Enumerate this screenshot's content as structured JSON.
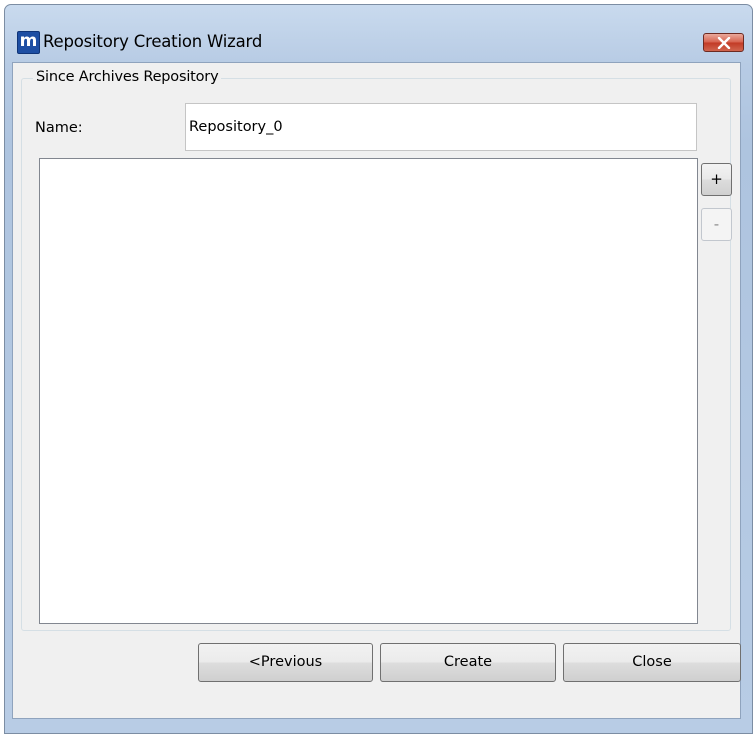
{
  "window": {
    "title": "Repository Creation Wizard",
    "app_icon_letter": "m"
  },
  "group": {
    "legend": "Since Archives Repository"
  },
  "name_field": {
    "label": "Name:",
    "value": "Repository_0"
  },
  "list": {
    "items": []
  },
  "side_buttons": {
    "add_label": "+",
    "remove_label": "-",
    "remove_enabled": false
  },
  "footer": {
    "previous_label": "<Previous",
    "create_label": "Create",
    "close_label": "Close"
  },
  "colors": {
    "title_gradient": "#b7cbe4",
    "client_background": "#f0f0f0",
    "close_button": "#c23a25",
    "app_icon": "#1d4ea3"
  }
}
